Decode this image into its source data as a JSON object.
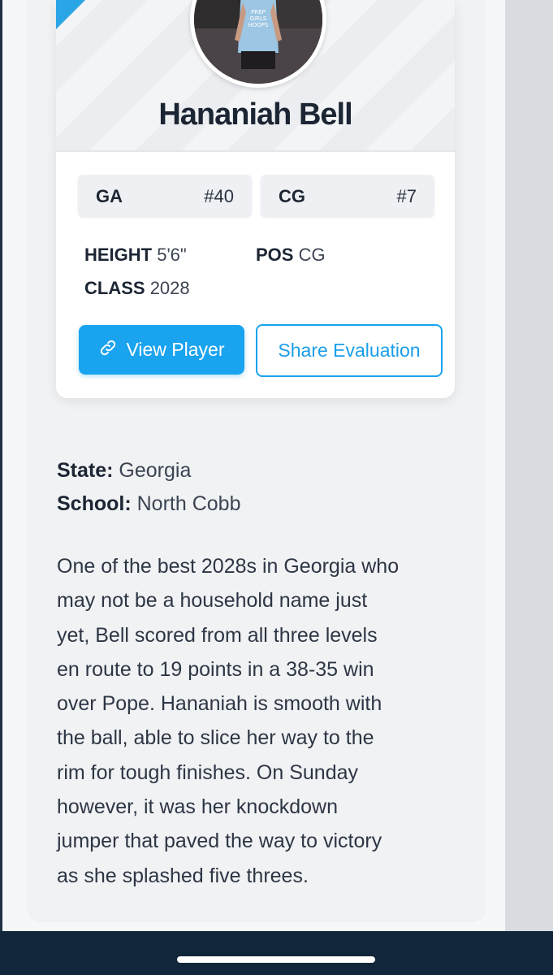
{
  "player": {
    "name": "Hananiah Bell",
    "state_code": "GA",
    "state_number": "#40",
    "position_code": "CG",
    "position_number": "#7",
    "height_label": "HEIGHT",
    "height_value": "5'6\"",
    "pos_label": "POS",
    "pos_value": "CG",
    "class_label": "CLASS",
    "class_value": "2028",
    "shirt_text_line1": "PREP",
    "shirt_text_line2": "GIRLS",
    "shirt_text_line3": "HOOPS"
  },
  "actions": {
    "view_player": "View Player",
    "share_evaluation": "Share Evaluation"
  },
  "details": {
    "state_label": "State:",
    "state_value": "Georgia",
    "school_label": "School:",
    "school_value": "North Cobb"
  },
  "evaluation": {
    "text": "One of the best 2028s in Georgia who\nmay not be a household name just\nyet, Bell scored from all three levels\nen route to 19 points in a 38-35 win\nover Pope. Hananiah is smooth with\nthe ball, able to slice her way to the\nrim for tough finishes. On Sunday\nhowever, it was her knockdown\njumper that paved the way to victory\nas she splashed five threes."
  },
  "colors": {
    "accent": "#1aa3ef",
    "navy": "#11263a",
    "text": "#1c2533"
  },
  "icons": {
    "view_player_icon": "link-icon"
  }
}
